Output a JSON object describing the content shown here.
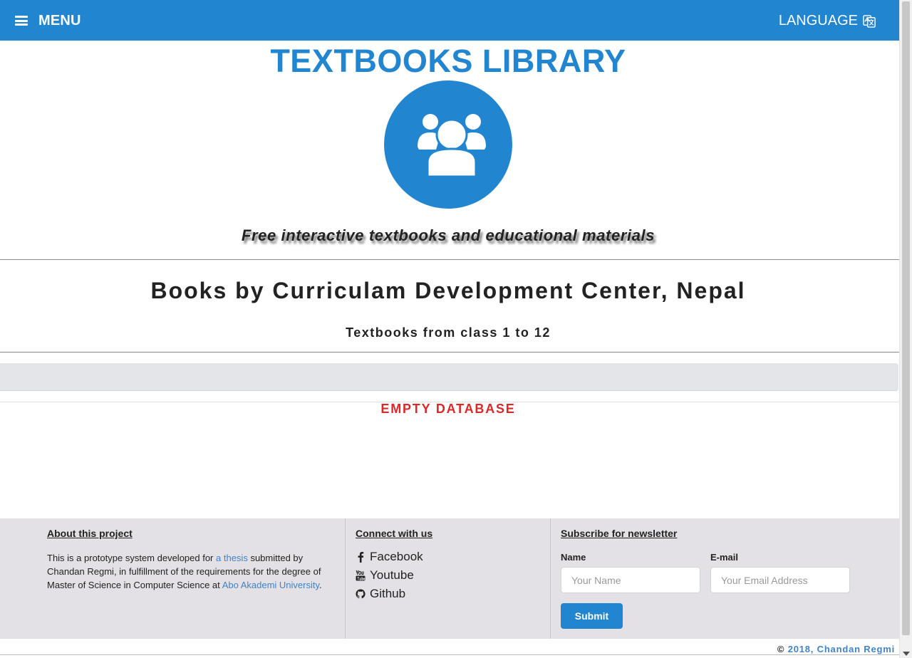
{
  "navbar": {
    "menu_label": "MENU",
    "language_label": "LANGUAGE",
    "menu_icon": "hamburger-icon",
    "language_icon": "translate-icon",
    "background_color": "#2185d0"
  },
  "header": {
    "title": "TEXTBOOKS LIBRARY",
    "logo_icon": "users-icon",
    "tagline": "Free interactive textbooks and educational materials"
  },
  "section": {
    "title": "Books by Curriculam Development Center, Nepal",
    "subtitle": "Textbooks from class 1 to 12",
    "empty_message": "EMPTY DATABASE"
  },
  "footer": {
    "about": {
      "heading": "About this project",
      "text_1": "This is a prototype system developed for ",
      "thesis_link": "a thesis",
      "text_2": " submitted by Chandan Regmi, in fulfillment of the requirements for the degree of Master of Science in Computer Science at ",
      "university_link": "Abo Akademi University",
      "text_3": "."
    },
    "connect": {
      "heading": "Connect with us",
      "links": [
        {
          "label": "Facebook",
          "icon": "facebook-icon"
        },
        {
          "label": "Youtube",
          "icon": "youtube-icon"
        },
        {
          "label": "Github",
          "icon": "github-icon"
        }
      ]
    },
    "newsletter": {
      "heading": "Subscribe for newsletter",
      "name_label": "Name",
      "name_placeholder": "Your Name",
      "email_label": "E-mail",
      "email_placeholder": "Your Email Address",
      "submit_label": "Submit"
    },
    "copyright_symbol": "©",
    "copyright_link": "2018, Chandan Regmi"
  },
  "colors": {
    "primary": "#2185d0",
    "error": "#db2828",
    "link": "#4183c4",
    "footer_bg": "#e3e1e6"
  }
}
